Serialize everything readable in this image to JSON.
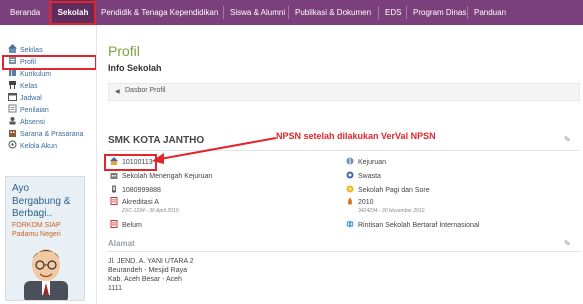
{
  "nav": {
    "items": [
      "Beranda",
      "Sekolah",
      "Pendidik & Tenaga Kependidikan",
      "Siswa & Alumni",
      "Publikasi & Dokumen",
      "EDS",
      "Program Dinas",
      "Panduan"
    ],
    "active": "Sekolah"
  },
  "sidebar": {
    "items": [
      "Sekilas",
      "Profil",
      "Kurikulum",
      "Kelas",
      "Jadwal",
      "Penilaian",
      "Absensi",
      "Sarana & Prasarana",
      "Kelola Akun"
    ],
    "active": "Profil"
  },
  "promo": {
    "line1": "Ayo",
    "line2": "Bergabung & Berbagi..",
    "line3": "FORKOM SIAP",
    "line4": "Padamu Negeri"
  },
  "page": {
    "title": "Profil",
    "subtitle": "Info Sekolah",
    "breadcrumb": "Dasbor Profil"
  },
  "school": {
    "name": "SMK KOTA JANTHO",
    "npsn": "10100113",
    "jenjang": "Sekolah Menengah Kejuruan",
    "phone": "1080999888",
    "akreditasi": "Akreditasi A",
    "akreditasi_note": "ZXC-1234 - 30 April 2010",
    "iso": "Belum",
    "bentuk": "Kejuruan",
    "status": "Swasta",
    "waktu": "Sekolah Pagi dan Sore",
    "tahun": "2010",
    "tahun_note": "3424234 - 30 November 2010",
    "rintisan": "Rintisan Sekolah Bertaraf Internasional"
  },
  "annotation": {
    "callout": "NPSN setelah dilakukan VerVal NPSN"
  },
  "alamat": {
    "label": "Alamat",
    "lines": [
      "Jl. JEND. A. YANI UTARA 2",
      "Beurandeh - Mesjid Raya",
      "Kab. Aceh Besar - Aceh",
      "1111"
    ]
  },
  "colors": {
    "nav_bg": "#7b3f7b",
    "nav_active": "#5e2d5e",
    "title_green": "#7aa33e",
    "highlight_red": "#e0262c",
    "link_blue": "#3b6aa0"
  }
}
